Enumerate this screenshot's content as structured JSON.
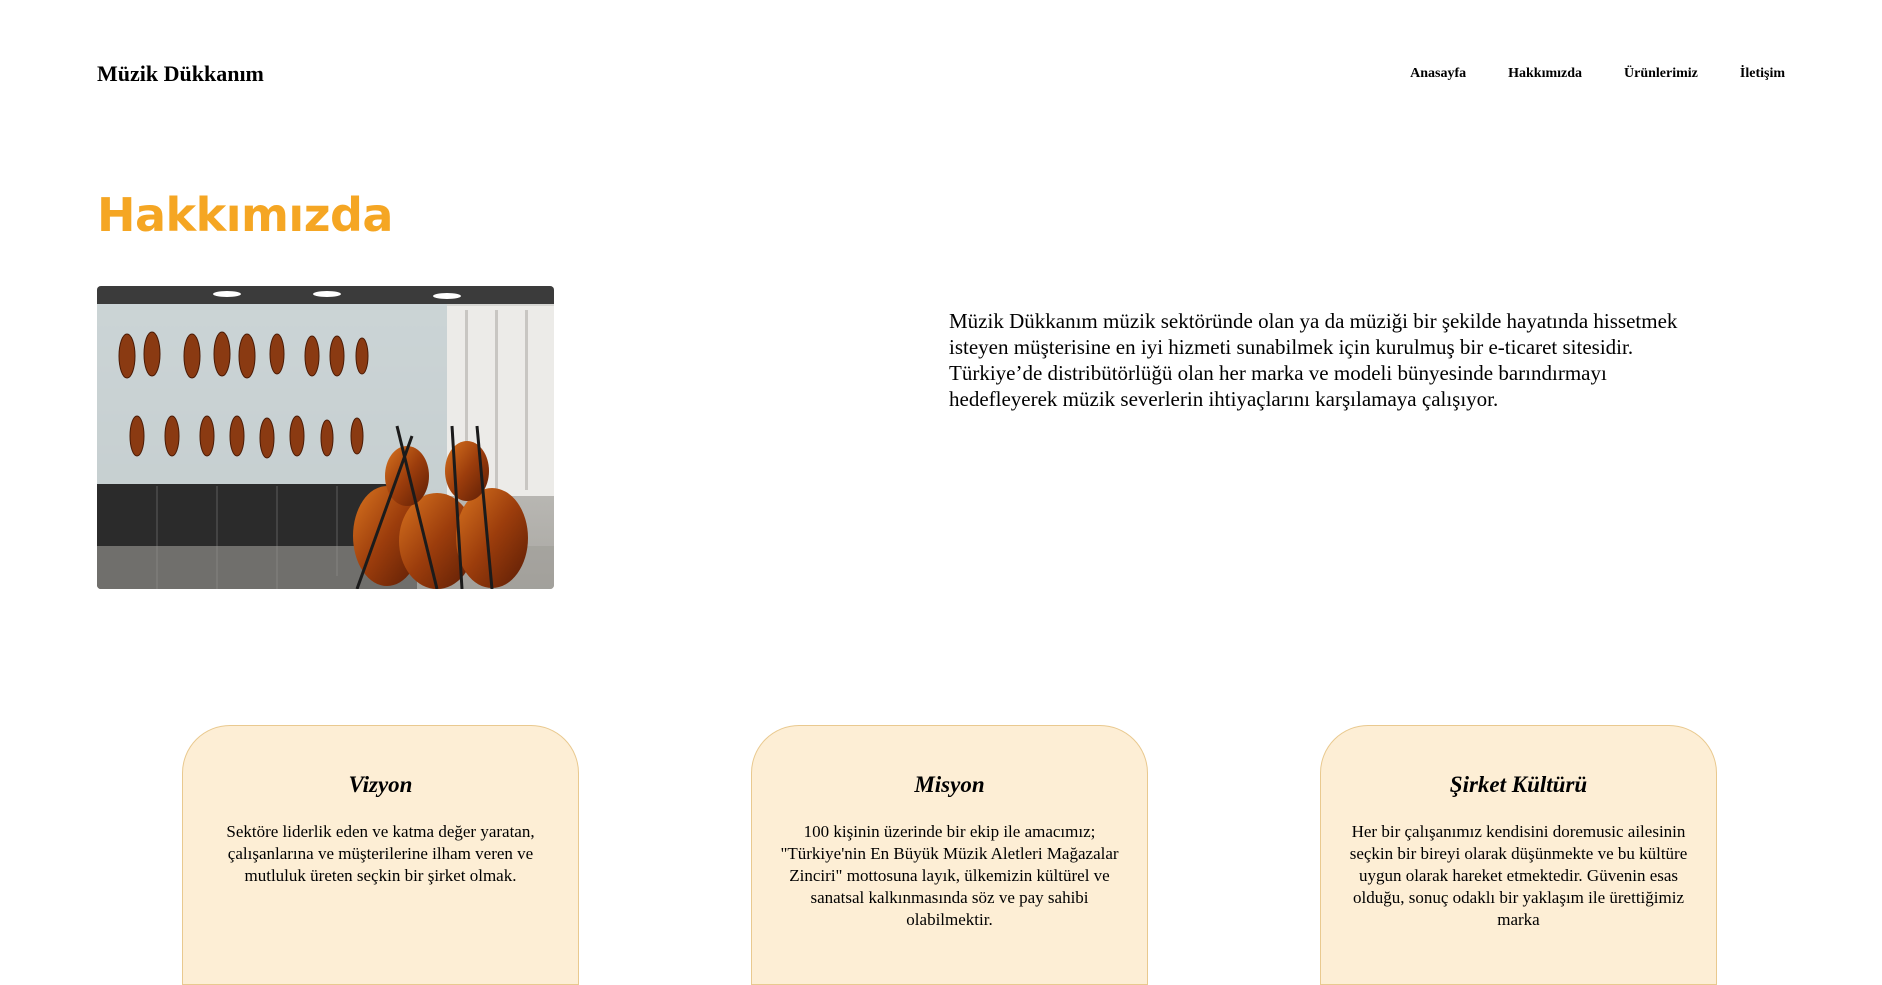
{
  "header": {
    "brand": "Müzik Dükkanım",
    "nav": [
      "Anasayfa",
      "Hakkımızda",
      "Ürünlerimiz",
      "İletişim"
    ]
  },
  "about": {
    "title": "Hakkımızda",
    "title_color": "#f5a623",
    "body": "Müzik Dükkanım müzik sektöründe olan ya da müziği bir şekilde hayatında hissetmek isteyen müşterisine en iyi hizmeti sunabilmek için kurulmuş bir e-ticaret sitesidir. Türkiye’de distribütörlüğü olan her marka ve modeli bünyesinde barındırmayı hedefleyerek müzik severlerin ihtiyaçlarını karşılamaya çalışıyor."
  },
  "cards": [
    {
      "title": "Vizyon",
      "text": "Sektöre liderlik eden ve katma değer yaratan, çalışanlarına ve müşterilerine ilham veren ve mutluluk üreten seçkin bir şirket olmak."
    },
    {
      "title": "Misyon",
      "text": "100 kişinin üzerinde bir ekip ile amacımız; \"Türkiye'nin En Büyük Müzik Aletleri Mağazalar Zinciri\" mottosuna layık, ülkemizin kültürel ve sanatsal kalkınmasında söz ve pay sahibi olabilmektir."
    },
    {
      "title": "Şirket Kültürü",
      "text": "Her bir çalışanımız kendisini doremusic ailesinin seçkin bir bireyi olarak düşünmekte ve bu kültüre uygun olarak hareket etmektedir. Güvenin esas olduğu, sonuç odaklı bir yaklaşım ile ürettiğimiz marka"
    }
  ],
  "card_color": "#fdeed5"
}
